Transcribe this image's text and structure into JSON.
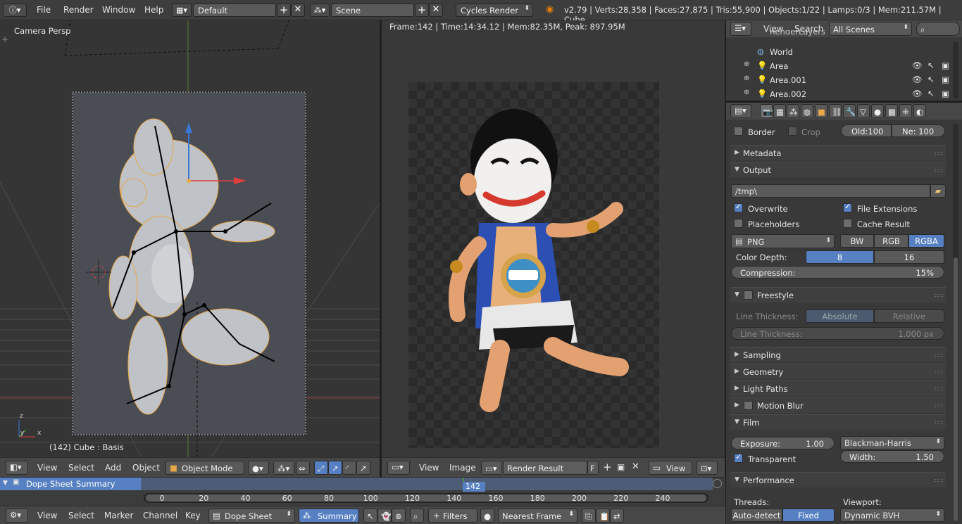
{
  "topbar": {
    "menus": [
      "File",
      "Render",
      "Window",
      "Help"
    ],
    "screen_layout": "Default",
    "scene": "Scene",
    "render_engine": "Cycles Render",
    "stats": "v2.79 | Verts:28,358 | Faces:27,875 | Tris:55,900 | Objects:1/22 | Lamps:0/3 | Mem:211.57M | Cube"
  },
  "viewport": {
    "view_name": "Camera Persp",
    "object_info": "(142) Cube : Basis",
    "header": {
      "menus": [
        "View",
        "Select",
        "Add",
        "Object"
      ],
      "mode": "Object Mode"
    }
  },
  "image_editor": {
    "render_info": "Frame:142 | Time:14:34.12 | Mem:82.35M, Peak: 897.95M",
    "header": {
      "menus": [
        "View",
        "Image"
      ],
      "image_name": "Render Result",
      "fake_user": "F",
      "view_label": "View"
    }
  },
  "outliner": {
    "menus": [
      "View",
      "Search"
    ],
    "filter": "All Scenes",
    "items": [
      {
        "label": "RenderLayers"
      },
      {
        "label": "World"
      },
      {
        "label": "Area"
      },
      {
        "label": "Area.001"
      },
      {
        "label": "Area.002"
      }
    ]
  },
  "properties": {
    "border_label": "Border",
    "crop_label": "Crop",
    "old_label": "Old:100",
    "new_label": "Ne: 100",
    "panels": {
      "metadata": "Metadata",
      "output": "Output",
      "freestyle": "Freestyle",
      "sampling": "Sampling",
      "geometry": "Geometry",
      "light_paths": "Light Paths",
      "motion_blur": "Motion Blur",
      "film": "Film",
      "performance": "Performance"
    },
    "output": {
      "path": "/tmp\\",
      "overwrite": "Overwrite",
      "file_extensions": "File Extensions",
      "placeholders": "Placeholders",
      "cache_result": "Cache Result",
      "format": "PNG",
      "color_modes": [
        "BW",
        "RGB",
        "RGBA"
      ],
      "color_depth_label": "Color Depth:",
      "color_depths": [
        "8",
        "16"
      ],
      "compression_label": "Compression:",
      "compression_value": "15%"
    },
    "freestyle": {
      "line_thickness_label": "Line Thickness:",
      "modes": [
        "Absolute",
        "Relative"
      ],
      "line_thickness_field": "Line Thickness:",
      "line_thickness_value": "1.000 px"
    },
    "film": {
      "exposure_label": "Exposure:",
      "exposure_value": "1.00",
      "filter": "Blackman-Harris",
      "transparent": "Transparent",
      "width_label": "Width:",
      "width_value": "1.50"
    },
    "performance": {
      "threads_label": "Threads:",
      "threads_modes": [
        "Auto-detect",
        "Fixed"
      ],
      "viewport_label": "Viewport:",
      "viewport_value": "Dynamic BVH"
    }
  },
  "timeline": {
    "channel": "Dope Sheet Summary",
    "current_frame": "142",
    "ticks": [
      "0",
      "20",
      "40",
      "60",
      "80",
      "100",
      "120",
      "140",
      "160",
      "180",
      "200",
      "220",
      "240"
    ]
  },
  "bottom_header": {
    "menus": [
      "View",
      "Select",
      "Marker",
      "Channel",
      "Key"
    ],
    "editor": "Dope Sheet",
    "summary": "Summary",
    "filters": "Filters",
    "snap": "Nearest Frame"
  },
  "colors": {
    "accent": "#5680c2",
    "selected_header": "#5680c2"
  }
}
